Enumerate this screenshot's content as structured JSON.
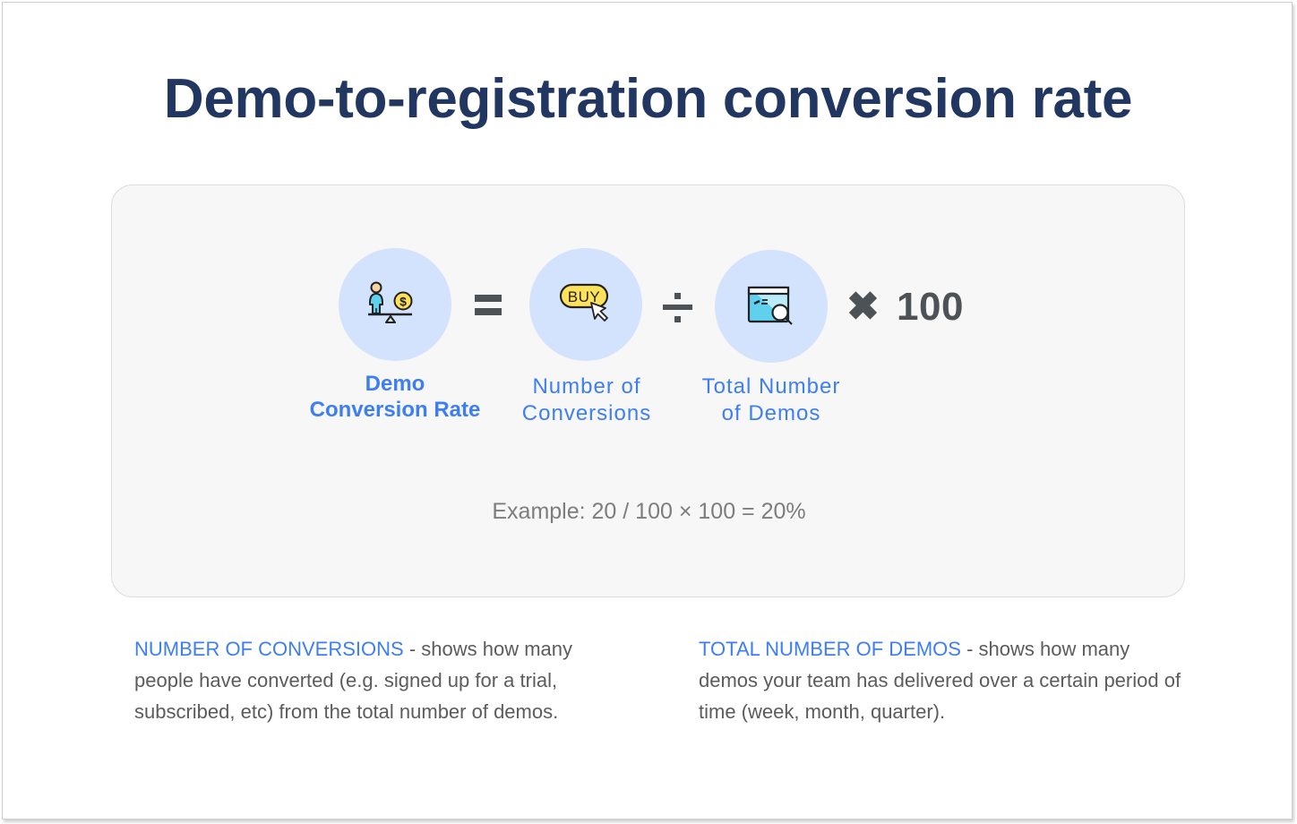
{
  "title": "Demo-to-registration conversion rate",
  "formula": {
    "terms": [
      {
        "icon": "balance-scale-person-coin-icon",
        "label_line1": "Demo",
        "label_line2": "Conversion Rate"
      },
      {
        "icon": "buy-button-cursor-icon",
        "label_line1": "Number of",
        "label_line2": "Conversions"
      },
      {
        "icon": "browser-window-search-icon",
        "label_line1": "Total Number",
        "label_line2": "of Demos"
      }
    ],
    "operators": {
      "equals": "=",
      "divide": "÷",
      "multiply": "✖",
      "multiplier": "100"
    },
    "example": "Example: 20 / 100 × 100 = 20%"
  },
  "definitions": [
    {
      "term": "NUMBER OF CONVERSIONS",
      "text": " - shows how many people have converted (e.g. signed up for a trial, subscribed, etc) from the total number of demos."
    },
    {
      "term": "TOTAL NUMBER OF DEMOS",
      "text": " - shows how many demos your team has delivered over a certain period of time (week, month, quarter)."
    }
  ],
  "colors": {
    "title": "#213762",
    "accent": "#3d7ef5",
    "circle": "#d3e2fd",
    "operator": "#4d5256",
    "body_text": "#5c5c5c",
    "example_text": "#7d7d7d"
  }
}
